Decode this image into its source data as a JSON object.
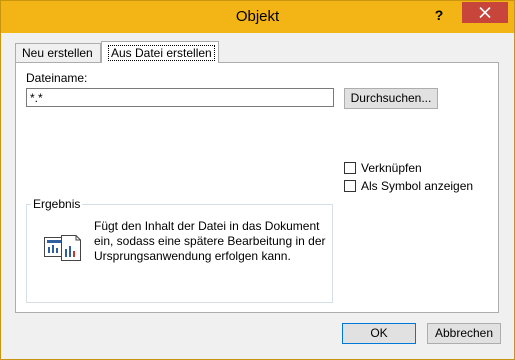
{
  "window": {
    "title": "Objekt"
  },
  "titlebar": {
    "help_label": "?",
    "close_icon": "close-icon"
  },
  "tabs": [
    {
      "label": "Neu erstellen",
      "active": false
    },
    {
      "label": "Aus Datei erstellen",
      "active": true
    }
  ],
  "form": {
    "filename_label": "Dateiname:",
    "filename_value": "*.*",
    "browse_label": "Durchsuchen...",
    "link_label": "Verknüpfen",
    "link_checked": false,
    "as_icon_label": "Als Symbol anzeigen",
    "as_icon_checked": false
  },
  "result": {
    "legend": "Ergebnis",
    "text": "Fügt den Inhalt der Datei in das Dokument ein, sodass eine spätere Bearbeitung in der Ursprungsanwendung erfolgen kann.",
    "icon": "embedded-document-icon"
  },
  "footer": {
    "ok_label": "OK",
    "cancel_label": "Abbrechen"
  }
}
